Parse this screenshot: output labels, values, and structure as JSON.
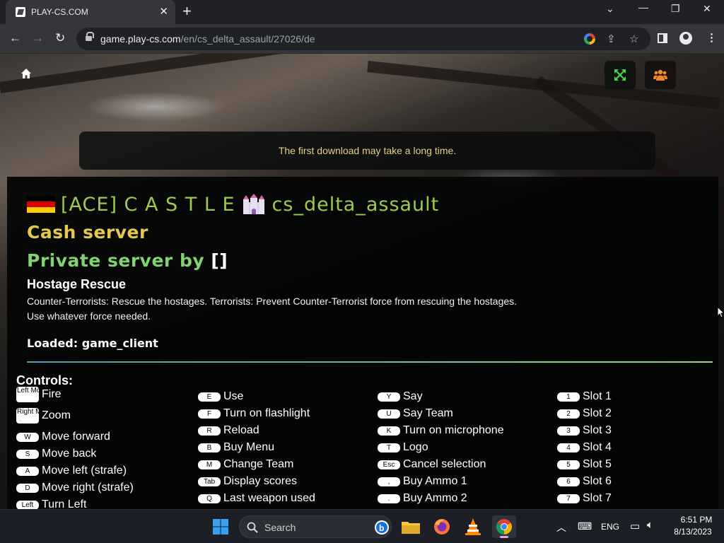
{
  "browser": {
    "tab_title": "PLAY-CS.COM",
    "url_host": "game.play-cs.com",
    "url_path": "/en/cs_delta_assault/27026/de"
  },
  "page": {
    "notice": "The first download may take a long time.",
    "server_name": "[ACE] C A S T L E",
    "map_name": "cs_delta_assault",
    "cash": "Cash server",
    "private_prefix": "Private server by",
    "private_owner": "[]",
    "mode_title": "Hostage Rescue",
    "mode_desc": "Counter-Terrorists: Rescue the hostages. Terrorists: Prevent Counter-Terrorist force from rescuing the hostages. Use whatever force needed.",
    "loaded": "Loaded: game_client",
    "controls_heading": "Controls:",
    "controls": [
      [
        {
          "key": "Left Mouse",
          "label": "Fire",
          "tall": true
        },
        {
          "key": "Right Mouse",
          "label": "Zoom",
          "tall": true
        },
        {
          "key": "W",
          "label": "Move forward"
        },
        {
          "key": "S",
          "label": "Move back"
        },
        {
          "key": "A",
          "label": "Move left (strafe)"
        },
        {
          "key": "D",
          "label": "Move right (strafe)"
        },
        {
          "key": "Left",
          "label": "Turn Left"
        }
      ],
      [
        {
          "key": "E",
          "label": "Use"
        },
        {
          "key": "F",
          "label": "Turn on flashlight"
        },
        {
          "key": "R",
          "label": "Reload"
        },
        {
          "key": "B",
          "label": "Buy Menu"
        },
        {
          "key": "M",
          "label": "Change Team"
        },
        {
          "key": "Tab",
          "label": "Display scores"
        },
        {
          "key": "Q",
          "label": "Last weapon used"
        }
      ],
      [
        {
          "key": "Y",
          "label": "Say"
        },
        {
          "key": "U",
          "label": "Say Team"
        },
        {
          "key": "K",
          "label": "Turn on microphone"
        },
        {
          "key": "T",
          "label": "Logo"
        },
        {
          "key": "Esc",
          "label": "Cancel selection"
        },
        {
          "key": ",",
          "label": "Buy Ammo 1"
        },
        {
          "key": ".",
          "label": "Buy Ammo 2"
        }
      ],
      [
        {
          "key": "1",
          "label": "Slot 1"
        },
        {
          "key": "2",
          "label": "Slot 2"
        },
        {
          "key": "3",
          "label": "Slot 3"
        },
        {
          "key": "4",
          "label": "Slot 4"
        },
        {
          "key": "5",
          "label": "Slot 5"
        },
        {
          "key": "6",
          "label": "Slot 6"
        },
        {
          "key": "7",
          "label": "Slot 7"
        }
      ]
    ]
  },
  "taskbar": {
    "search_label": "Search",
    "lang": "ENG",
    "time": "6:51 PM",
    "date": "8/13/2023"
  },
  "colors": {
    "title_green": "#9ccc4a",
    "cash_gold": "#e6c84d",
    "private_green": "#7fd470",
    "notice_text": "#e5cf8a"
  }
}
